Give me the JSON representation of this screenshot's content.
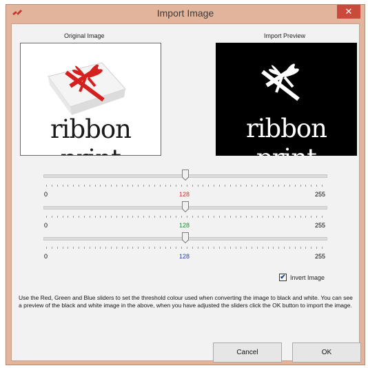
{
  "window": {
    "title": "Import Image",
    "close_glyph": "✕",
    "app_icon": "ribbon-logo-icon"
  },
  "labels": {
    "original": "Original Image",
    "preview": "Import Preview"
  },
  "images": {
    "original_text": "ribbon print",
    "preview_text": "ribbon print"
  },
  "sliders": [
    {
      "channel": "Red",
      "min": "0",
      "max": "255",
      "value": "128",
      "value_color": "#c0392b"
    },
    {
      "channel": "Green",
      "min": "0",
      "max": "255",
      "value": "128",
      "value_color": "#1e8a2e"
    },
    {
      "channel": "Blue",
      "min": "0",
      "max": "255",
      "value": "128",
      "value_color": "#2c3e9f"
    }
  ],
  "invert": {
    "label": "Invert Image",
    "checked": true,
    "check_glyph": "✔"
  },
  "description": "Use the Red, Green and Blue sliders to set the threshold colour used when converting the image to black and white. You can see a preview of the black and white image in the above, when you have adjusted the sliders click the OK button to import the image.",
  "buttons": {
    "cancel": "Cancel",
    "ok": "OK"
  }
}
